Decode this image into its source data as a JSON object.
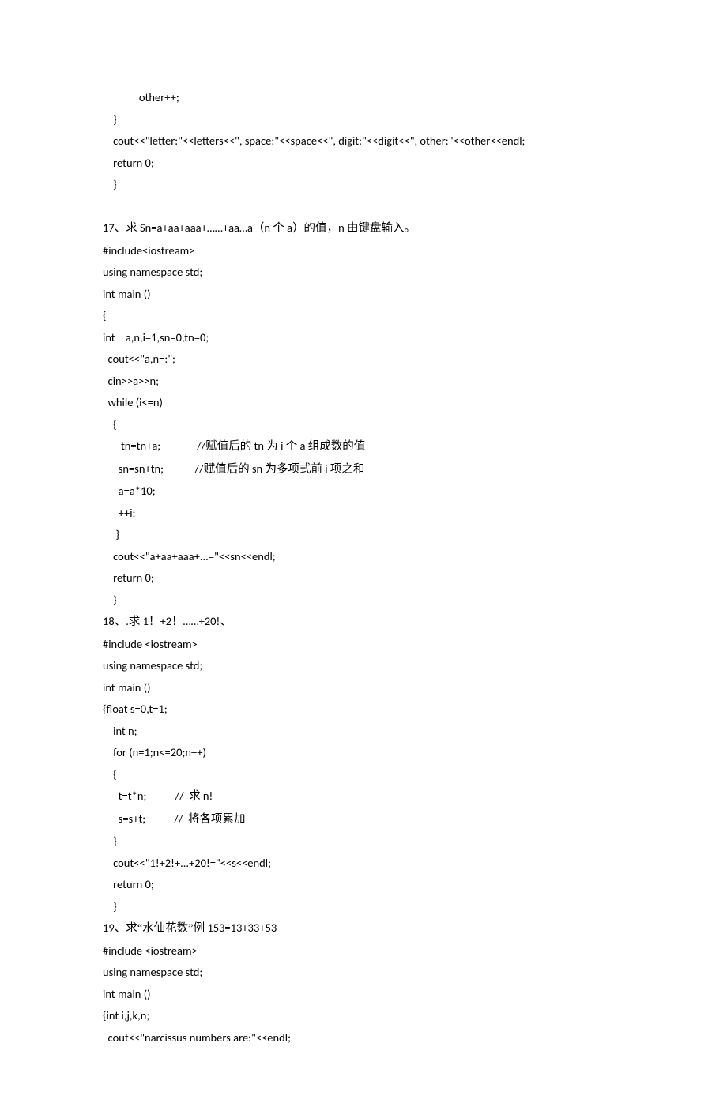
{
  "lines": [
    "              other++;",
    "    }",
    "    cout<<\"letter:\"<<letters<<\", space:\"<<space<<\", digit:\"<<digit<<\", other:\"<<other<<endl;",
    "    return 0;",
    "    }",
    "",
    {
      "prefix": "17",
      "cjk1": "、求",
      "mid1": " Sn=a+aa+aaa+……+aa…a",
      "cjk2": "（",
      "mid2": "n ",
      "cjk3": "个",
      "mid3": " a",
      "cjk4": "）的值，",
      "mid4": "n ",
      "cjk5": "由键盘输入。"
    },
    "#include<iostream>",
    "using namespace std;",
    "int main ()",
    "{",
    "int    a,n,i=1,sn=0,tn=0;",
    "  cout<<\"a,n=:\";",
    "  cin>>a>>n;",
    "  while (i<=n)",
    "    {",
    {
      "prefix": "       tn=tn+a;              //",
      "cjk1": "赋值后的",
      "mid1": " tn ",
      "cjk2": "为",
      "mid2": " i ",
      "cjk3": "个",
      "mid3": " a ",
      "cjk4": "组成数的值"
    },
    {
      "prefix": "      sn=sn+tn;            //",
      "cjk1": "赋值后的",
      "mid1": " sn ",
      "cjk2": "为多项式前",
      "mid2": " i ",
      "cjk3": "项之和"
    },
    "      a=a*10;",
    "      ++i;",
    "     }",
    "    cout<<\"a+aa+aaa+...=\"<<sn<<endl;",
    "    return 0;",
    "    }",
    {
      "prefix": "18",
      "cjk1": "、",
      "mid1": ".",
      "cjk2": "求",
      "mid2": " 1",
      "cjk3": "！",
      "mid3": "+2",
      "cjk4": "！",
      "mid4": "……+20!",
      "cjk5": "、"
    },
    "#include <iostream>",
    "using namespace std;",
    "int main ()",
    "{float s=0,t=1;",
    "    int n;",
    "    for (n=1;n<=20;n++)",
    "    {",
    {
      "prefix": "      t=t*n;           //  ",
      "cjk1": "求",
      "mid1": " n!"
    },
    {
      "prefix": "      s=s+t;           //  ",
      "cjk1": "将各项累加"
    },
    "    }",
    "    cout<<\"1!+2!+...+20!=\"<<s<<endl;",
    "    return 0;",
    "    }",
    {
      "prefix": "19",
      "cjk1": "、求“水仙花数”例",
      "mid1": " 153=13+33+53"
    },
    "#include <iostream>",
    "using namespace std;",
    "int main ()",
    "{int i,j,k,n;",
    "  cout<<\"narcissus numbers are:\"<<endl;"
  ]
}
